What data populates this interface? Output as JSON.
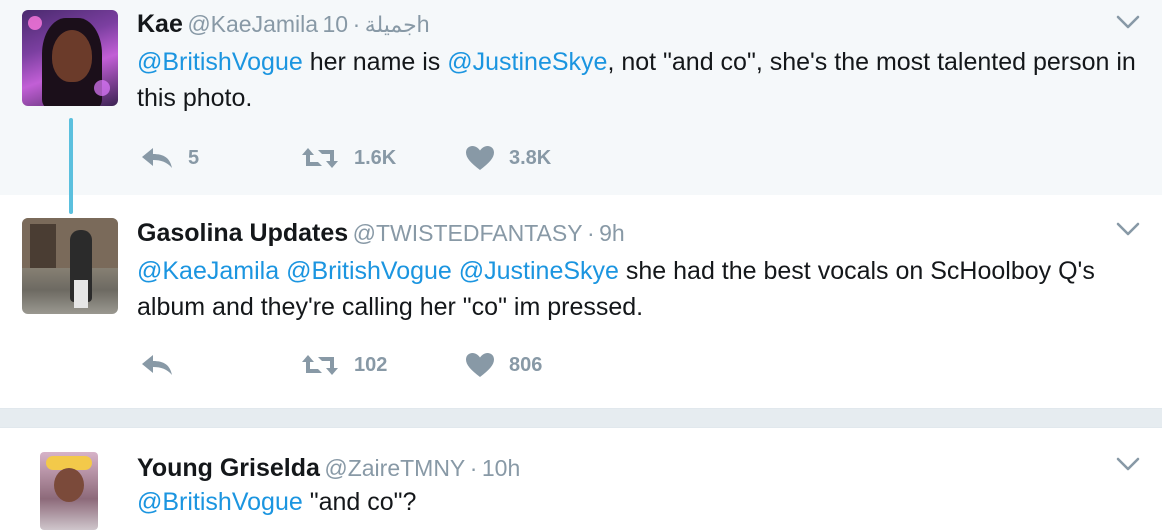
{
  "tweets": [
    {
      "name": "Kae",
      "handle": "@KaeJamila",
      "extra_name": "جميلة",
      "sep": "·",
      "time": "10h",
      "mention1": "@BritishVogue",
      "text1": " her name is ",
      "mention2": "@JustineSkye",
      "text2": ", not \"and co\", she's the most talented person in this photo.",
      "replies": "5",
      "retweets": "1.6K",
      "likes": "3.8K"
    },
    {
      "name": "Gasolina Updates",
      "handle": "@TWISTEDFANTASY",
      "sep": "·",
      "time": "9h",
      "mention1": "@KaeJamila",
      "mention2": "@BritishVogue",
      "mention3": "@JustineSkye",
      "text": " she had the best vocals on ScHoolboy Q's album and they're calling her \"co\" im pressed.",
      "retweets": "102",
      "likes": "806"
    },
    {
      "name": "Young Griselda",
      "handle": "@ZaireTMNY",
      "sep": "·",
      "time": "10h",
      "mention1": "@BritishVogue",
      "text": " \"and co\"?"
    }
  ],
  "icons": {
    "reply": "reply-icon",
    "retweet": "retweet-icon",
    "like": "heart-icon",
    "more": "chevron-down-icon"
  },
  "colors": {
    "link": "#1b95e0",
    "muted": "#8899a6",
    "thread_line": "#5bc0de",
    "highlight_bg": "#f5f8fa"
  }
}
